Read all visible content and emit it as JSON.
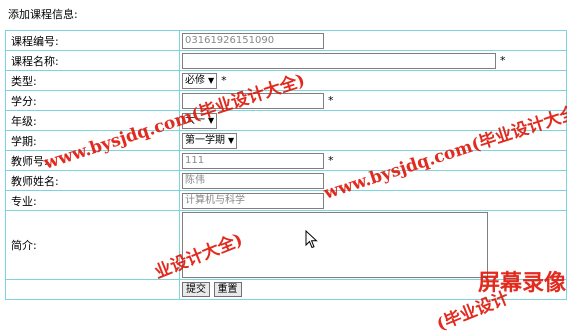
{
  "title": "添加课程信息:",
  "fields": {
    "course_id": {
      "label": "课程编号:",
      "value": "03161926151090"
    },
    "course_name": {
      "label": "课程名称:",
      "value": ""
    },
    "type": {
      "label": "类型:",
      "value": "必修"
    },
    "credit": {
      "label": "学分:",
      "value": ""
    },
    "grade": {
      "label": "年级:",
      "value": "大一"
    },
    "semester": {
      "label": "学期:",
      "value": "第一学期"
    },
    "teacher_id": {
      "label": "教师号:",
      "value": "111"
    },
    "teacher_name": {
      "label": "教师姓名:",
      "value": "陈伟"
    },
    "major": {
      "label": "专业:",
      "value": "计算机与科学"
    },
    "intro": {
      "label": "简介:",
      "value": ""
    }
  },
  "required_mark": "*",
  "buttons": {
    "submit": "提交",
    "reset": "重置"
  },
  "watermarks": {
    "site": "www.bysjdq.com(毕业设计大全)",
    "fragment1": "业设计大全)",
    "fragment2": "(毕业设计",
    "fragment3": "屏幕录像"
  },
  "colors": {
    "border": "#7fd3dc",
    "watermark": "#e0180c"
  }
}
